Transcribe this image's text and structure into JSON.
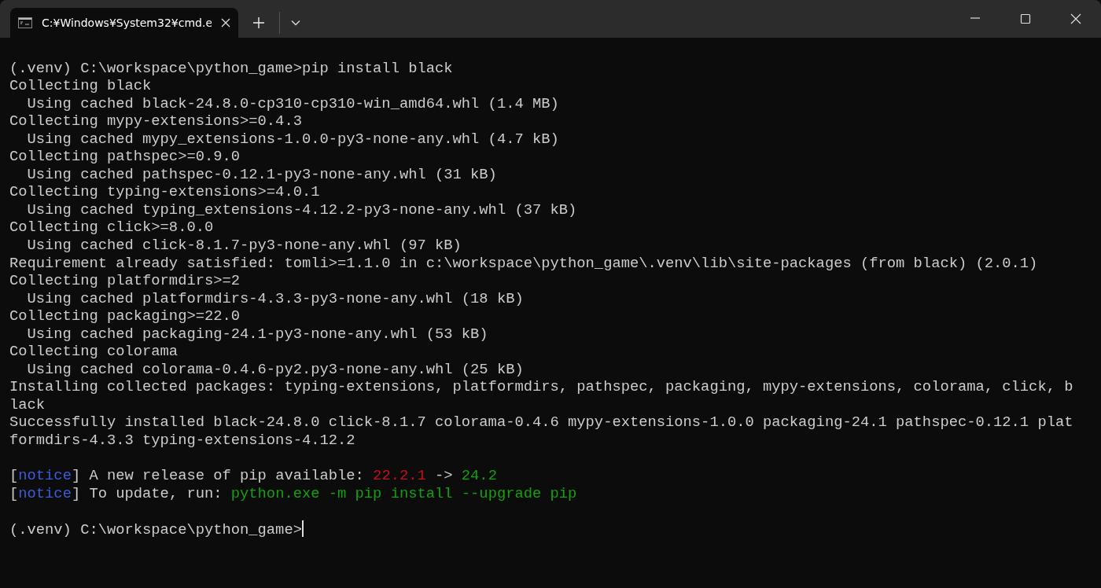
{
  "window": {
    "tabs": [
      {
        "title": "C:¥Windows¥System32¥cmd.e",
        "selected": true
      }
    ]
  },
  "terminal": {
    "lines": [
      {
        "kind": "blank"
      },
      {
        "kind": "text",
        "segments": [
          {
            "text": "(.venv) C:\\workspace\\python_game>pip install black"
          }
        ]
      },
      {
        "kind": "text",
        "segments": [
          {
            "text": "Collecting black"
          }
        ]
      },
      {
        "kind": "text",
        "segments": [
          {
            "text": "  Using cached black-24.8.0-cp310-cp310-win_amd64.whl (1.4 MB)"
          }
        ]
      },
      {
        "kind": "text",
        "segments": [
          {
            "text": "Collecting mypy-extensions>=0.4.3"
          }
        ]
      },
      {
        "kind": "text",
        "segments": [
          {
            "text": "  Using cached mypy_extensions-1.0.0-py3-none-any.whl (4.7 kB)"
          }
        ]
      },
      {
        "kind": "text",
        "segments": [
          {
            "text": "Collecting pathspec>=0.9.0"
          }
        ]
      },
      {
        "kind": "text",
        "segments": [
          {
            "text": "  Using cached pathspec-0.12.1-py3-none-any.whl (31 kB)"
          }
        ]
      },
      {
        "kind": "text",
        "segments": [
          {
            "text": "Collecting typing-extensions>=4.0.1"
          }
        ]
      },
      {
        "kind": "text",
        "segments": [
          {
            "text": "  Using cached typing_extensions-4.12.2-py3-none-any.whl (37 kB)"
          }
        ]
      },
      {
        "kind": "text",
        "segments": [
          {
            "text": "Collecting click>=8.0.0"
          }
        ]
      },
      {
        "kind": "text",
        "segments": [
          {
            "text": "  Using cached click-8.1.7-py3-none-any.whl (97 kB)"
          }
        ]
      },
      {
        "kind": "text",
        "segments": [
          {
            "text": "Requirement already satisfied: tomli>=1.1.0 in c:\\workspace\\python_game\\.venv\\lib\\site-packages (from black) (2.0.1)"
          }
        ]
      },
      {
        "kind": "text",
        "segments": [
          {
            "text": "Collecting platformdirs>=2"
          }
        ]
      },
      {
        "kind": "text",
        "segments": [
          {
            "text": "  Using cached platformdirs-4.3.3-py3-none-any.whl (18 kB)"
          }
        ]
      },
      {
        "kind": "text",
        "segments": [
          {
            "text": "Collecting packaging>=22.0"
          }
        ]
      },
      {
        "kind": "text",
        "segments": [
          {
            "text": "  Using cached packaging-24.1-py3-none-any.whl (53 kB)"
          }
        ]
      },
      {
        "kind": "text",
        "segments": [
          {
            "text": "Collecting colorama"
          }
        ]
      },
      {
        "kind": "text",
        "segments": [
          {
            "text": "  Using cached colorama-0.4.6-py2.py3-none-any.whl (25 kB)"
          }
        ]
      },
      {
        "kind": "text",
        "segments": [
          {
            "text": "Installing collected packages: typing-extensions, platformdirs, pathspec, packaging, mypy-extensions, colorama, click, b"
          }
        ]
      },
      {
        "kind": "text",
        "segments": [
          {
            "text": "lack"
          }
        ]
      },
      {
        "kind": "text",
        "segments": [
          {
            "text": "Successfully installed black-24.8.0 click-8.1.7 colorama-0.4.6 mypy-extensions-1.0.0 packaging-24.1 pathspec-0.12.1 plat"
          }
        ]
      },
      {
        "kind": "text",
        "segments": [
          {
            "text": "formdirs-4.3.3 typing-extensions-4.12.2"
          }
        ]
      },
      {
        "kind": "blank"
      },
      {
        "kind": "text",
        "segments": [
          {
            "text": "["
          },
          {
            "text": "notice",
            "color": "#3b5bdb"
          },
          {
            "text": "] A new release of pip available: "
          },
          {
            "text": "22.2.1",
            "color": "#c50f1f"
          },
          {
            "text": " -> "
          },
          {
            "text": "24.2",
            "color": "#13a10e"
          }
        ]
      },
      {
        "kind": "text",
        "segments": [
          {
            "text": "["
          },
          {
            "text": "notice",
            "color": "#3b5bdb"
          },
          {
            "text": "] To update, run: "
          },
          {
            "text": "python.exe -m pip install --upgrade pip",
            "color": "#13a10e"
          }
        ]
      },
      {
        "kind": "blank"
      }
    ],
    "prompt": {
      "text": "(.venv) C:\\workspace\\python_game>",
      "cursor": true
    }
  }
}
